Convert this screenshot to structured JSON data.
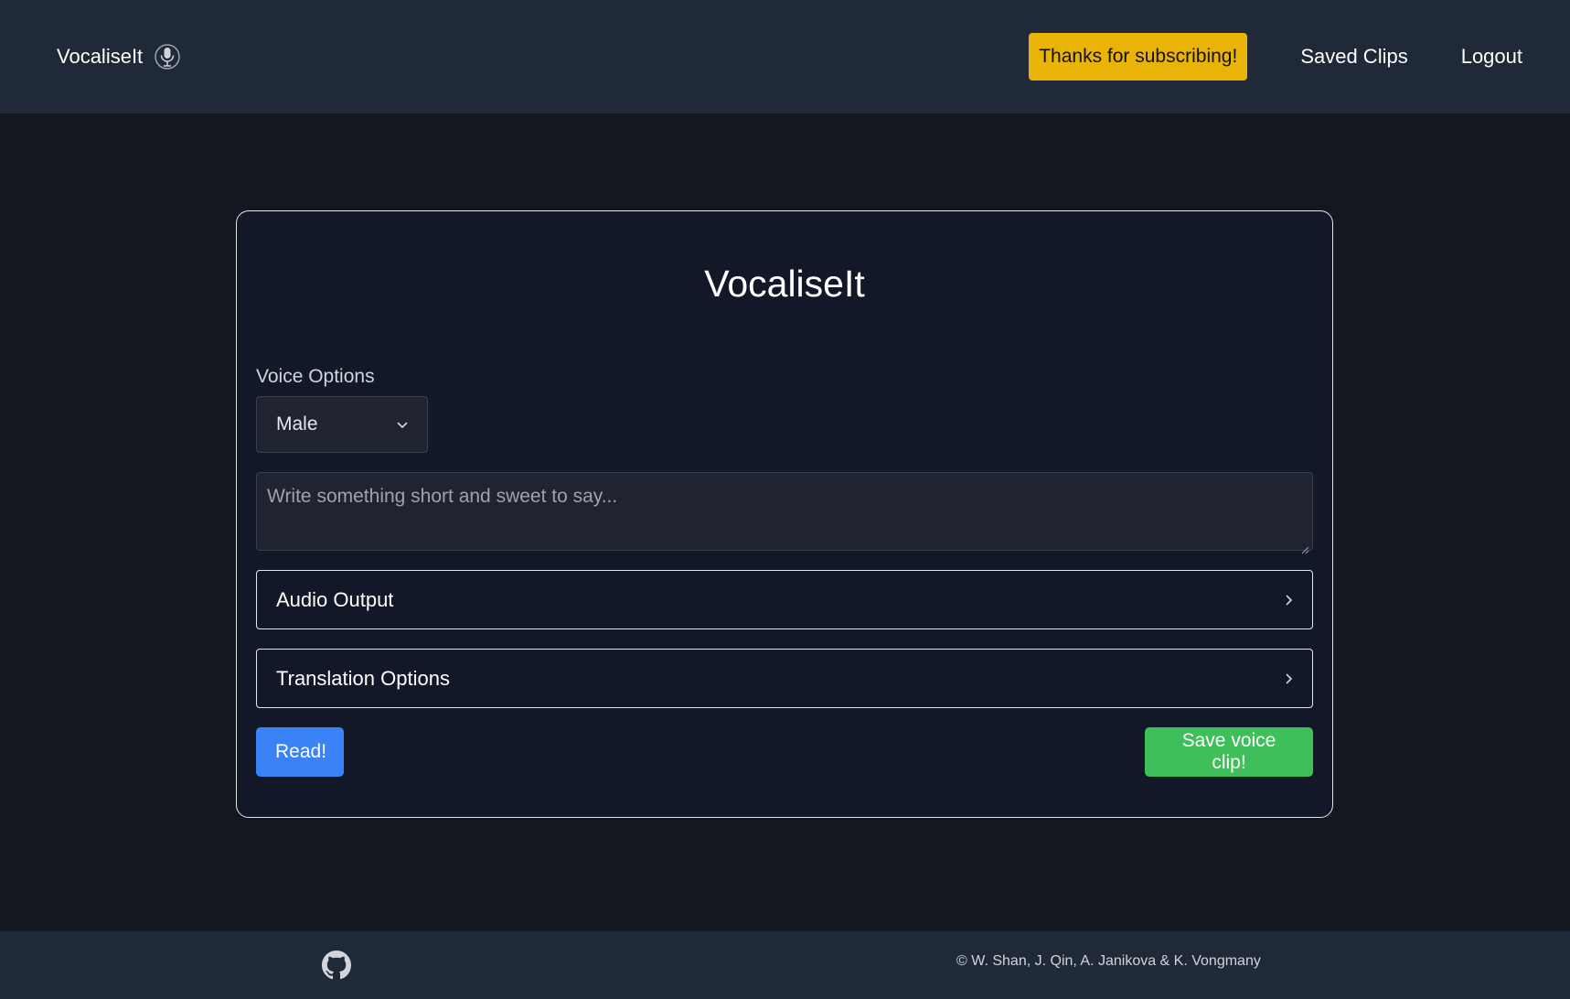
{
  "navbar": {
    "brand": "VocaliseIt",
    "brand_icon": "microphone-icon",
    "subscribe_label": "Thanks for subscribing!",
    "links": [
      "Saved Clips",
      "Logout"
    ]
  },
  "card": {
    "title": "VocaliseIt",
    "voice_label": "Voice Options",
    "voice_selected": "Male",
    "text_placeholder": "Write something short and sweet to say...",
    "accordion_audio": "Audio Output",
    "accordion_translation": "Translation Options",
    "read_label": "Read!",
    "save_label": "Save voice clip!"
  },
  "footer": {
    "github_icon": "github-icon",
    "copyright": "© W. Shan, J. Qin, A. Janikova & K. Vongmany"
  },
  "colors": {
    "nav_bg": "#1f2937",
    "page_bg": "#131720",
    "subscribe": "#eab308",
    "read": "#3b82f6",
    "save": "#3fbf5a"
  }
}
